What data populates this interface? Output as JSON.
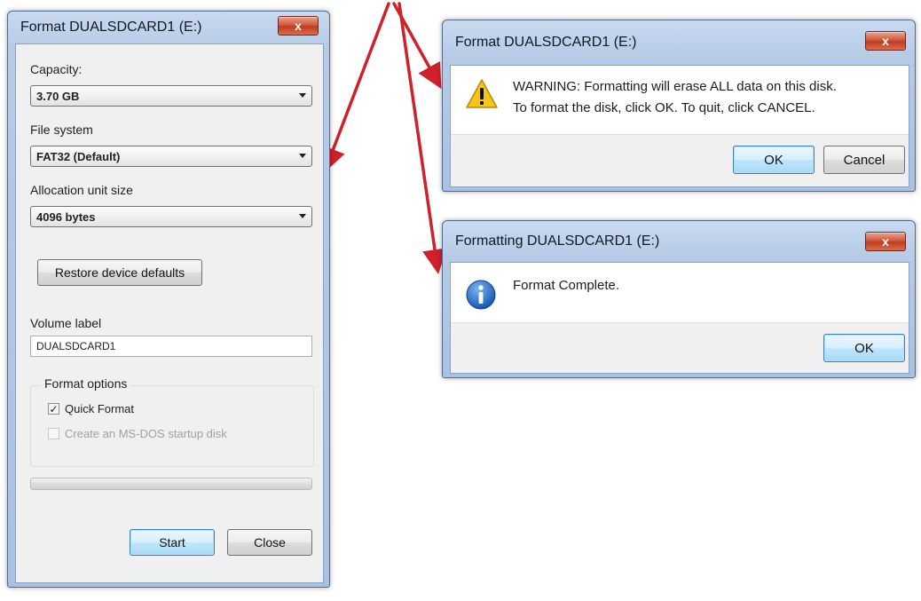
{
  "format_dialog": {
    "title": "Format DUALSDCARD1 (E:)",
    "close_glyph": "x",
    "capacity": {
      "label": "Capacity:",
      "value": "3.70 GB"
    },
    "file_system": {
      "label": "File system",
      "value": "FAT32 (Default)"
    },
    "allocation": {
      "label": "Allocation unit size",
      "value": "4096 bytes"
    },
    "restore_button": "Restore device defaults",
    "volume_label": {
      "label": "Volume label",
      "value": "DUALSDCARD1"
    },
    "format_options": {
      "label": "Format options",
      "quick_format": {
        "label": "Quick Format",
        "checked": true
      },
      "msdos_startup": {
        "label": "Create an MS-DOS startup disk",
        "checked": false,
        "enabled": false
      }
    },
    "progress": 0,
    "start_button": "Start",
    "close_button": "Close"
  },
  "warning_dialog": {
    "title": "Format DUALSDCARD1 (E:)",
    "close_glyph": "x",
    "icon": "warning-icon",
    "line1": "WARNING: Formatting will erase ALL data on this disk.",
    "line2": "To format the disk, click OK. To quit, click CANCEL.",
    "ok_button": "OK",
    "cancel_button": "Cancel"
  },
  "complete_dialog": {
    "title": "Formatting DUALSDCARD1 (E:)",
    "close_glyph": "x",
    "icon": "info-icon",
    "message": "Format Complete.",
    "ok_button": "OK"
  },
  "colors": {
    "annotation_arrow": "#d0202a",
    "titlebar": "#b7cbe7",
    "close_button": "#c9472a"
  },
  "check_glyph": "✓"
}
